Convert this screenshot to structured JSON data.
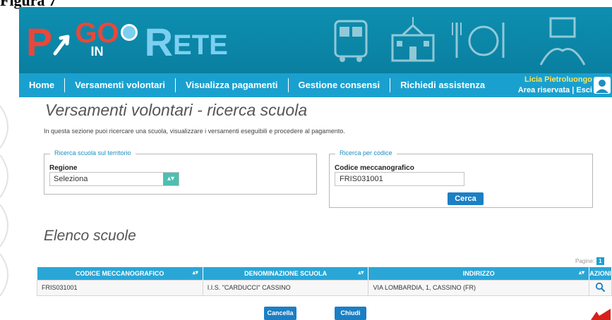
{
  "figure_label": "Figura 7",
  "logo": {
    "p": "P",
    "go": "GO",
    "in": "IN",
    "r": "R",
    "ete": "ETE"
  },
  "nav": {
    "items": [
      "Home",
      "Versamenti volontari",
      "Visualizza pagamenti",
      "Gestione consensi",
      "Richiedi assistenza"
    ],
    "user_name": "Licia Pietroluongo",
    "area_riservata": "Area riservata",
    "esci": "Esci",
    "links_sep": " | "
  },
  "page": {
    "title": "Versamenti volontari - ricerca scuola",
    "intro": "In questa sezione puoi ricercare una scuola, visualizzare i versamenti eseguibili e procedere al pagamento."
  },
  "search_territory": {
    "legend": "Ricerca scuola sul territorio",
    "regione_label": "Regione",
    "regione_value": "Seleziona"
  },
  "search_code": {
    "legend": "Ricerca per codice",
    "code_label": "Codice meccanografico",
    "code_value": "FRIS031001",
    "search_button": "Cerca"
  },
  "list": {
    "title": "Elenco scuole",
    "pagine_label": "Pagine:",
    "current_page": "1",
    "columns": [
      "CODICE MECCANOGRAFICO",
      "DENOMINAZIONE SCUOLA",
      "INDIRIZZO",
      "AZIONI"
    ],
    "rows": [
      {
        "codice": "FRIS031001",
        "denominazione": "I.I.S. \"CARDUCCI\" CASSINO",
        "indirizzo": "VIA LOMBARDIA, 1, CASSINO (FR)",
        "action_icon": "search-icon"
      }
    ]
  },
  "buttons": {
    "cancella": "Cancella",
    "chiudi": "Chiudi"
  },
  "colors": {
    "nav": "#1aa0cf",
    "banner": "#0a7fa0",
    "table_header": "#2aa6d6",
    "button": "#1c7fc4",
    "user_name": "#ffe45c",
    "logo_red": "#e8483b",
    "logo_blue": "#7ccff0"
  }
}
